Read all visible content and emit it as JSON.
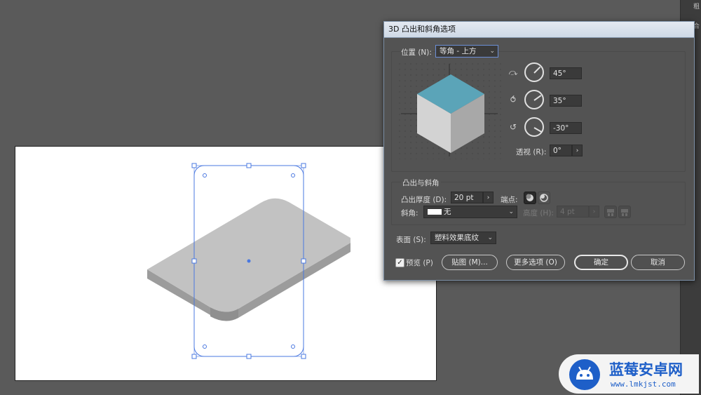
{
  "dialog": {
    "title": "3D 凸出和斜角选项",
    "position": {
      "label": "位置 (N):",
      "value": "等角 - 上方",
      "rot_x": "45°",
      "rot_y": "35°",
      "rot_z": "-30°",
      "perspective_label": "透视 (R):",
      "perspective_value": "0°"
    },
    "extrude": {
      "section": "凸出与斜角",
      "depth_label": "凸出厚度 (D):",
      "depth_value": "20 pt",
      "cap_label": "端点:",
      "bevel_label": "斜角:",
      "bevel_value": "无",
      "height_label": "高度 (H):",
      "height_value": "4 pt"
    },
    "surface": {
      "label": "表面 (S):",
      "value": "塑料效果底纹"
    },
    "preview_label": "预览 (P)",
    "preview_checked": true,
    "buttons": {
      "map": "贴图 (M)...",
      "more": "更多选项 (O)",
      "ok": "确定",
      "cancel": "取消"
    }
  },
  "right_strip": {
    "t1": "粗",
    "t2": "合"
  },
  "watermark": {
    "title": "蓝莓安卓网",
    "url": "www.lmkjst.com"
  },
  "colors": {
    "cube_top": "#5ba4b8",
    "cube_left": "#d3d3d3",
    "cube_right": "#a8a8a8",
    "shape_top": "#c2c2c2",
    "shape_side": "#9c9c9c",
    "selection": "#4a78e0",
    "watermark_blue": "#1e5fc8"
  }
}
